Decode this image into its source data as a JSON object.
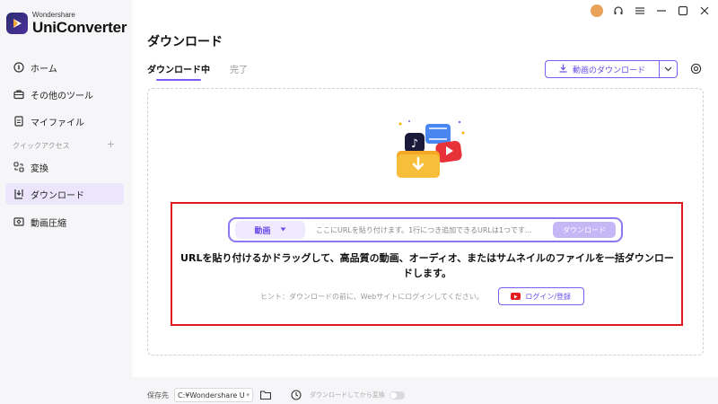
{
  "brand": {
    "company": "Wondershare",
    "product": "UniConverter"
  },
  "sidebar": {
    "items": [
      {
        "label": "ホーム",
        "icon": "home-icon"
      },
      {
        "label": "その他のツール",
        "icon": "toolbox-icon"
      },
      {
        "label": "マイファイル",
        "icon": "file-icon"
      },
      {
        "label": "変換",
        "icon": "convert-icon"
      },
      {
        "label": "ダウンロード",
        "icon": "download-icon",
        "active": true
      },
      {
        "label": "動画圧縮",
        "icon": "compress-icon"
      }
    ],
    "quick_access_label": "クイックアクセス",
    "quick_access_add": "+"
  },
  "window_controls": [
    "avatar-icon",
    "headset-icon",
    "menu-icon",
    "minimize-icon",
    "maximize-icon",
    "close-icon"
  ],
  "main": {
    "title": "ダウンロード",
    "tabs": [
      {
        "label": "ダウンロード中",
        "active": true
      },
      {
        "label": "完了",
        "active": false
      }
    ],
    "video_download_button": "動画のダウンロード",
    "url_bar": {
      "type_label": "動画",
      "placeholder": "ここにURLを貼り付けます。1行につき追加できるURLは1つです...",
      "download_button": "ダウンロード"
    },
    "message": "URLを貼り付けるかドラッグして、高品質の動画、オーディオ、またはサムネイルのファイルを一括ダウンロードします。",
    "hint": "ヒント：ダウンロードの前に、Webサイトにログインしてください。",
    "login_button": "ログイン/登録"
  },
  "bottom": {
    "save_label": "保存先",
    "path_value": "C:¥Wondershare U",
    "convert_after_label": "ダウンロードしてから変換"
  },
  "colors": {
    "accent": "#7a5cf0",
    "highlight_border": "#e0191e",
    "youtube": "#e31b23"
  }
}
